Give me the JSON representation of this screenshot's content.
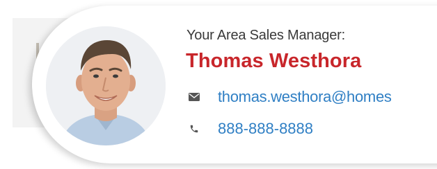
{
  "contact": {
    "label": "Your Area Sales Manager:",
    "name": "Thomas Westhora",
    "email": "thomas.westhora@homes",
    "phone": "888-888-8888",
    "email_icon": "envelope-icon",
    "phone_icon": "phone-icon"
  },
  "colors": {
    "name": "#c8262b",
    "link": "#2f7fc4",
    "label": "#3a3a3a",
    "icon": "#555555"
  }
}
